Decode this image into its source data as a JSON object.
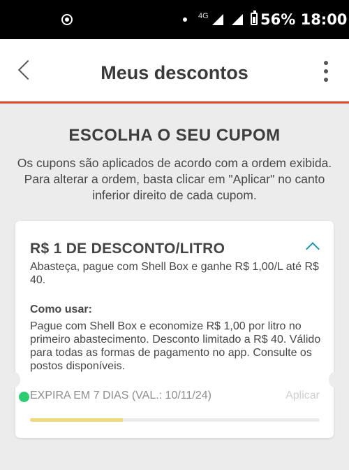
{
  "status_bar": {
    "network": "4G",
    "battery_time": "56% 18:00"
  },
  "app_bar": {
    "title": "Meus descontos"
  },
  "page": {
    "heading": "ESCOLHA O SEU CUPOM",
    "instructions": "Os cupons são aplicados de acordo com a ordem exibida. Para alterar a ordem, basta clicar em \"Aplicar\" no canto inferior direito de cada cupom."
  },
  "coupon": {
    "title": "R$ 1 DE DESCONTO/LITRO",
    "description": "Abasteça, pague com Shell Box e ganhe R$ 1,00/L até R$ 40.",
    "how_to_use_label": "Como usar:",
    "how_to_use_text": "Pague com Shell Box e economize R$  1,00 por litro no primeiro abastecimento. Desconto limitado a R$ 40. Válido para todas as formas de pagamento no app. Consulte os postos disponíveis.",
    "expiry": "EXPIRA EM 7 DIAS  (VAL.: 10/11/24)",
    "apply_label": "Aplicar",
    "validity_progress": 0.32,
    "status_color": "#2ecc71",
    "accent_color": "#1b97a8"
  },
  "colors": {
    "header_rule": "#d8452e",
    "progress_fill": "#f0d97c"
  },
  "icons": [
    "record-icon",
    "signal-icon",
    "battery-icon",
    "back-arrow-icon",
    "more-vert-icon",
    "chevron-up-icon"
  ]
}
